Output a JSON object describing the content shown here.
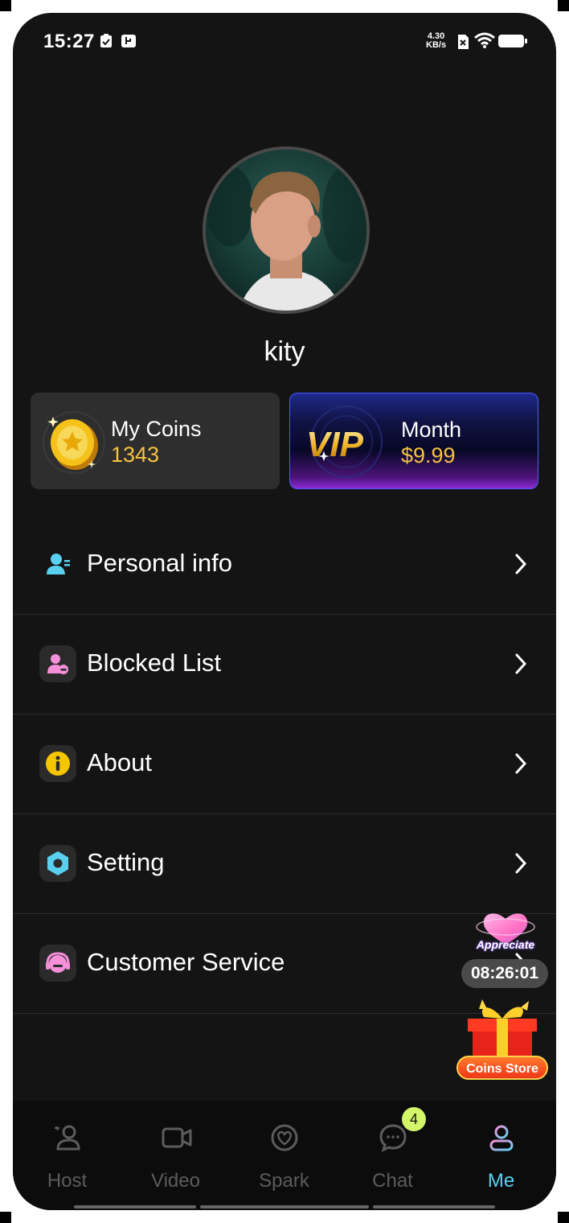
{
  "status_bar": {
    "time": "15:27",
    "speed_value": "4.30",
    "speed_unit": "KB/s"
  },
  "profile": {
    "username": "kity"
  },
  "coins_card": {
    "title": "My Coins",
    "value": "1343"
  },
  "vip_card": {
    "badge": "VIP",
    "title": "Month",
    "price": "$9.99"
  },
  "menu": [
    {
      "label": "Personal info",
      "icon": "person-info-icon",
      "color": "#5ad0f0"
    },
    {
      "label": "Blocked List",
      "icon": "blocked-user-icon",
      "color": "#f58fd8"
    },
    {
      "label": "About",
      "icon": "info-icon",
      "color": "#f5c500"
    },
    {
      "label": "Setting",
      "icon": "hexagon-settings-icon",
      "color": "#5ad0f0"
    },
    {
      "label": "Customer Service",
      "icon": "headset-icon",
      "color": "#f58fd8"
    }
  ],
  "floating": {
    "appreciate_label": "Appreciate",
    "timer": "08:26:01",
    "coins_store_label": "Coins Store"
  },
  "tabs": [
    {
      "label": "Host",
      "icon": "host-icon",
      "active": false
    },
    {
      "label": "Video",
      "icon": "video-icon",
      "active": false
    },
    {
      "label": "Spark",
      "icon": "spark-icon",
      "active": false
    },
    {
      "label": "Chat",
      "icon": "chat-icon",
      "active": false,
      "badge": "4"
    },
    {
      "label": "Me",
      "icon": "me-icon",
      "active": true
    }
  ],
  "colors": {
    "background": "#141414",
    "accent": "#5ad0f0",
    "gold": "#f5c242",
    "badge": "#d2f56a"
  }
}
